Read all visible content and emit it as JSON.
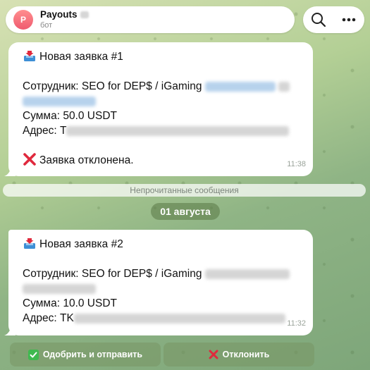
{
  "header": {
    "title": "Payouts",
    "subtitle": "бот",
    "avatar_letter": "P"
  },
  "messages": [
    {
      "title": "Новая заявка #1",
      "employee_label": "Сотрудник:",
      "employee_value": "SEO for DEP$ / iGaming",
      "amount_label": "Сумма:",
      "amount_value": "50.0 USDT",
      "address_label": "Адрес:",
      "address_prefix": "T",
      "status": "Заявка отклонена.",
      "time": "11:38"
    },
    {
      "title": "Новая заявка #2",
      "employee_label": "Сотрудник:",
      "employee_value": "SEO for DEP$ / iGaming",
      "amount_label": "Сумма:",
      "amount_value": "10.0 USDT",
      "address_label": "Адрес:",
      "address_prefix": "TK",
      "time": "11:32"
    }
  ],
  "unread_label": "Непрочитанные сообщения",
  "date_label": "01 августа",
  "keyboard": {
    "approve_label": "Одобрить и отправить",
    "reject_label": "Отклонить"
  },
  "colors": {
    "avatar": "#ef5a6f",
    "reject_icon": "#e0293d",
    "approve_icon": "#3fb94f",
    "inbox_icon": "#3d8fd6"
  },
  "icons": [
    "search-icon",
    "more-icon",
    "inbox-tray-icon",
    "cross-mark-icon",
    "check-mark-icon"
  ]
}
